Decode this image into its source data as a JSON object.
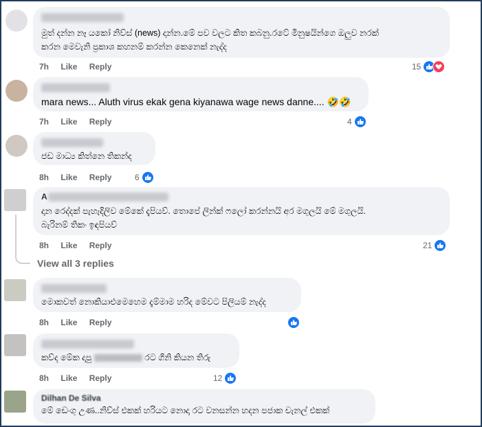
{
  "actions": {
    "like": "Like",
    "reply": "Reply"
  },
  "comments": [
    {
      "text_lines": [
        "මුත් දන්න නෑ යකෝ නිව්ස් (news) දාන්න.මේ පව වලට කිත කබනු.රටේ මිනුෂයින්ගෙ ඔලුව නරක්",
        "කරන මෙවැනි ප්‍රකාශ කහනම් කරන්න කෙනෙක් නැද්ද"
      ],
      "time": "7h",
      "count": "15"
    },
    {
      "text_lines": [
        "mara news... Aluth virus ekak gena kiyanawa wage news danne.... 🤣🤣"
      ],
      "time": "7h",
      "count": "4"
    },
    {
      "text_lines": [
        "ජඩ මාධ්‍ය කිත්නෙ තිකන්ද"
      ],
      "time": "8h",
      "count": "6"
    },
    {
      "name_prefix": "A",
      "text_lines": [
        "දාන රෙද්දක් පැහැදිලිව මේකේ දැපියව්. තොපේ ලින්ක් ෆලෝ කරන්නයි අර මගුලයි මේ මගුලයි.",
        "බැරිනම් තිකං ඉඳපියව්"
      ],
      "time": "8h",
      "count": "21"
    },
    {
      "text_lines": [
        "මොකවත් නොකියාඑමෙහෙම දැම්මාම හරිද මේවට පිලියම් නැද්ද"
      ],
      "time": "8h",
      "count": ""
    },
    {
      "text_before": "කව්ද මේක දාපු",
      "text_after": "රට ගිනි කියන තිරු",
      "time": "8h",
      "count": "12"
    },
    {
      "name": "Dilhan De Silva",
      "text_lines": [
        "මේ ඩෙංගු උණ..නිව්ස් එකක් හරියට නොදා රට වනසන්න හදන පජාක චැනල් එකක්"
      ]
    }
  ],
  "view_replies": "View all 3 replies"
}
